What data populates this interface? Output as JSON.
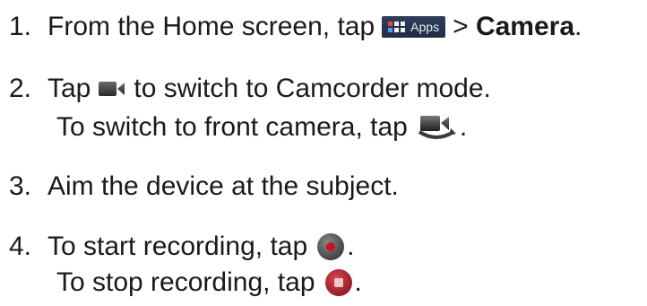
{
  "steps": [
    {
      "number": "1.",
      "text_before": "From the Home screen, tap",
      "apps_label": "Apps",
      "text_after": "> ",
      "bold_target": "Camera",
      "end": "."
    },
    {
      "number": "2.",
      "text_before": "Tap",
      "icon": "camcorder-icon",
      "text_after": "to switch to Camcorder mode.",
      "sub": {
        "text_before": "To switch to front camera, tap",
        "icon": "switch-camera-icon",
        "end": "."
      }
    },
    {
      "number": "3.",
      "text": "Aim the device at the subject."
    },
    {
      "number": "4.",
      "text_before": "To start recording, tap",
      "icon": "record-button-icon",
      "end": ".",
      "sub": {
        "text_before": "To stop recording, tap",
        "icon": "stop-button-icon",
        "end": "."
      }
    }
  ],
  "colors": {
    "text": "#1a1a1a",
    "apps_bg": "#25334e",
    "record_red": "#c8141e",
    "stop_red": "#a8232c"
  }
}
